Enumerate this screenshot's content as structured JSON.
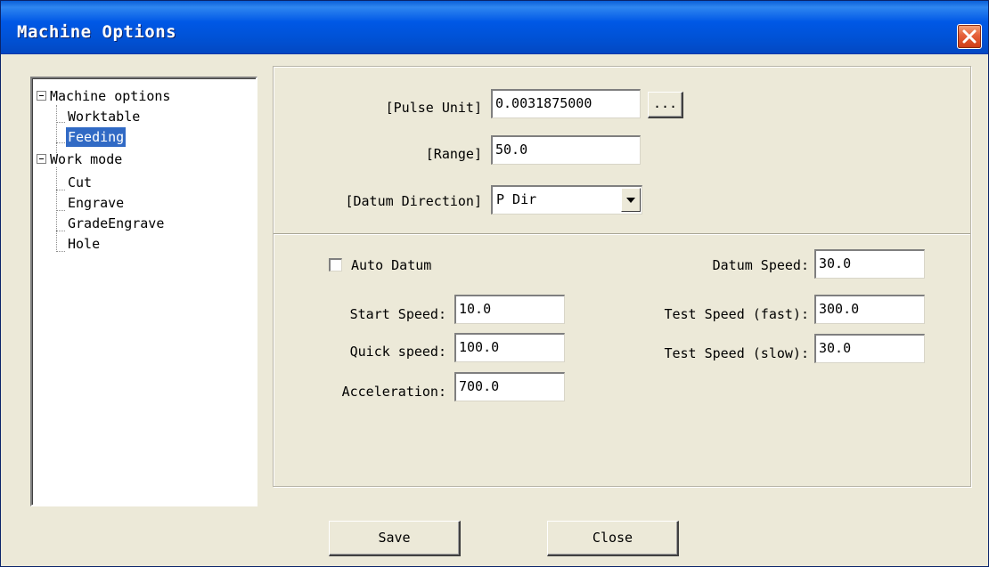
{
  "window": {
    "title": "Machine Options"
  },
  "tree": {
    "items": [
      {
        "label": "Machine options",
        "level": 0,
        "expanded": true,
        "selected": false
      },
      {
        "label": "Worktable",
        "level": 1,
        "selected": false
      },
      {
        "label": "Feeding",
        "level": 1,
        "selected": true
      },
      {
        "label": "Work mode",
        "level": 0,
        "expanded": true,
        "selected": false
      },
      {
        "label": "Cut",
        "level": 1,
        "selected": false
      },
      {
        "label": "Engrave",
        "level": 1,
        "selected": false
      },
      {
        "label": "GradeEngrave",
        "level": 1,
        "selected": false
      },
      {
        "label": "Hole",
        "level": 1,
        "selected": false
      }
    ]
  },
  "top_section": {
    "pulse_unit_label": "[Pulse Unit]",
    "pulse_unit_value": "0.0031875000",
    "browse_label": "...",
    "range_label": "[Range]",
    "range_value": "50.0",
    "datum_direction_label": "[Datum Direction]",
    "datum_direction_value": "P Dir"
  },
  "bottom_section": {
    "auto_datum_label": "Auto Datum",
    "auto_datum_checked": false,
    "start_speed_label": "Start Speed:",
    "start_speed_value": "10.0",
    "quick_speed_label": "Quick speed:",
    "quick_speed_value": "100.0",
    "acceleration_label": "Acceleration:",
    "acceleration_value": "700.0",
    "datum_speed_label": "Datum Speed:",
    "datum_speed_value": "30.0",
    "test_speed_fast_label": "Test Speed (fast):",
    "test_speed_fast_value": "300.0",
    "test_speed_slow_label": "Test Speed (slow):",
    "test_speed_slow_value": "30.0"
  },
  "buttons": {
    "save_label": "Save",
    "close_label": "Close"
  },
  "colors": {
    "titlebar": "#0054e3",
    "selection": "#316ac5",
    "dialog_bg": "#ece9d8",
    "close_button": "#e5603a"
  },
  "icons": {
    "close": "close-icon",
    "dropdown": "chevron-down-icon",
    "expander": "collapse-icon"
  }
}
